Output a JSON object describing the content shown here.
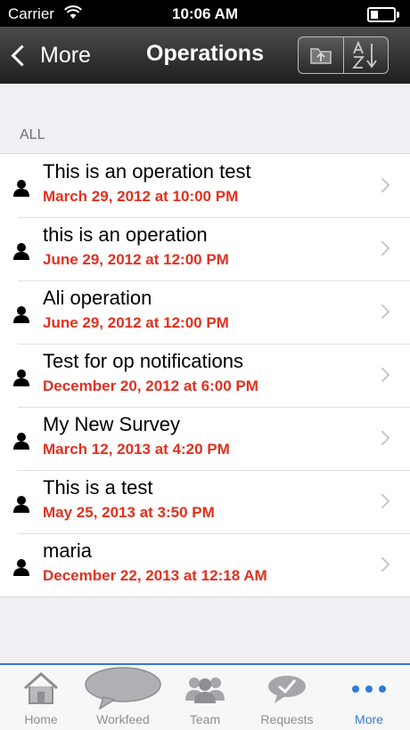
{
  "status_bar": {
    "carrier": "Carrier",
    "time": "10:06 AM"
  },
  "nav": {
    "back_label": "More",
    "title": "Operations"
  },
  "section": {
    "header": "ALL"
  },
  "operations": [
    {
      "title": "This is an operation test",
      "date": "March 29, 2012 at 10:00 PM"
    },
    {
      "title": "this is an operation",
      "date": "June 29, 2012 at 12:00 PM"
    },
    {
      "title": "Ali operation",
      "date": "June 29, 2012 at 12:00 PM"
    },
    {
      "title": "Test for op notifications",
      "date": "December 20, 2012 at 6:00 PM"
    },
    {
      "title": "My New Survey",
      "date": "March 12, 2013 at 4:20 PM"
    },
    {
      "title": "This is a test",
      "date": "May 25, 2013 at 3:50 PM"
    },
    {
      "title": "maria",
      "date": "December 22, 2013 at 12:18 AM"
    }
  ],
  "tabs": [
    {
      "label": "Home",
      "icon": "home-icon"
    },
    {
      "label": "Workfeed",
      "icon": "speech-bubble-icon"
    },
    {
      "label": "Team",
      "icon": "group-icon"
    },
    {
      "label": "Requests",
      "icon": "request-check-icon"
    },
    {
      "label": "More",
      "icon": "more-dots-icon",
      "active": true
    }
  ],
  "colors": {
    "accent": "#2e7bd6",
    "date_red": "#e2301f",
    "nav_dark": "#2b2b2b"
  }
}
